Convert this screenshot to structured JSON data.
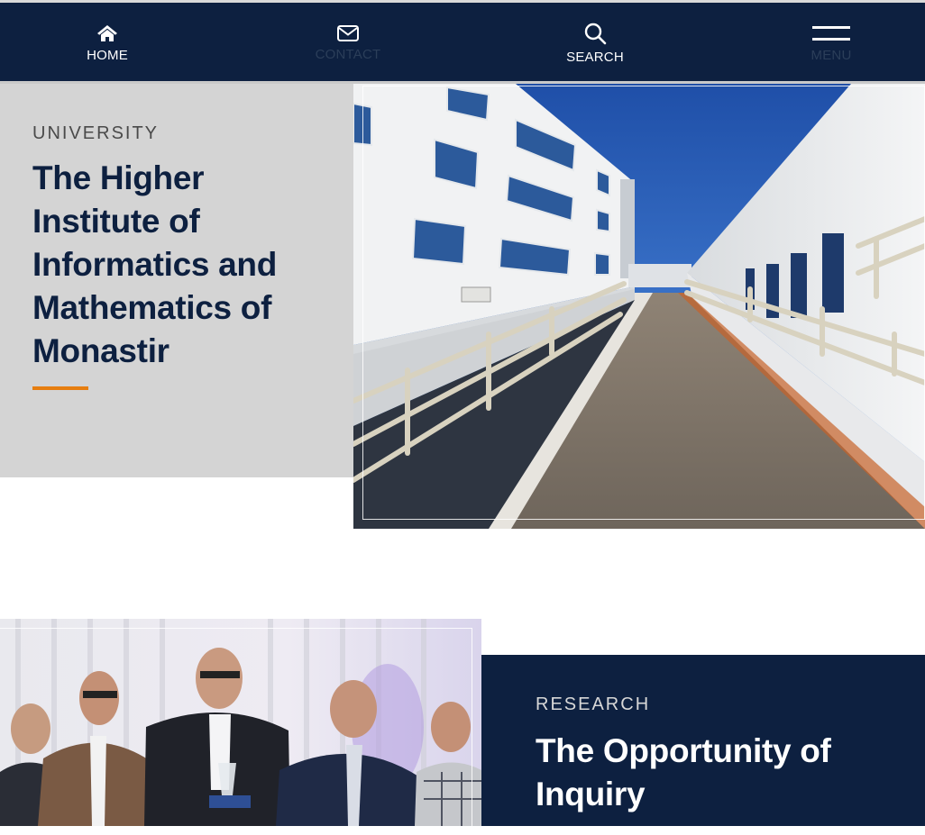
{
  "nav": {
    "items": [
      {
        "label": "HOME",
        "icon": "home-icon",
        "active": true
      },
      {
        "label": "CONTACT",
        "icon": "envelope-icon",
        "active": false
      },
      {
        "label": "SEARCH",
        "icon": "search-icon",
        "active": true
      },
      {
        "label": "MENU",
        "icon": "hamburger-icon",
        "active": false
      }
    ]
  },
  "intro": {
    "eyebrow": "UNIVERSITY",
    "title": "The Higher Institute of Informatics and Mathematics of Monastir",
    "accent_color": "#e67e10"
  },
  "research": {
    "eyebrow": "RESEARCH",
    "title": "The Opportunity of Inquiry"
  },
  "colors": {
    "navy": "#0d2040",
    "gray_card": "#d4d4d4",
    "accent": "#e67e10"
  }
}
